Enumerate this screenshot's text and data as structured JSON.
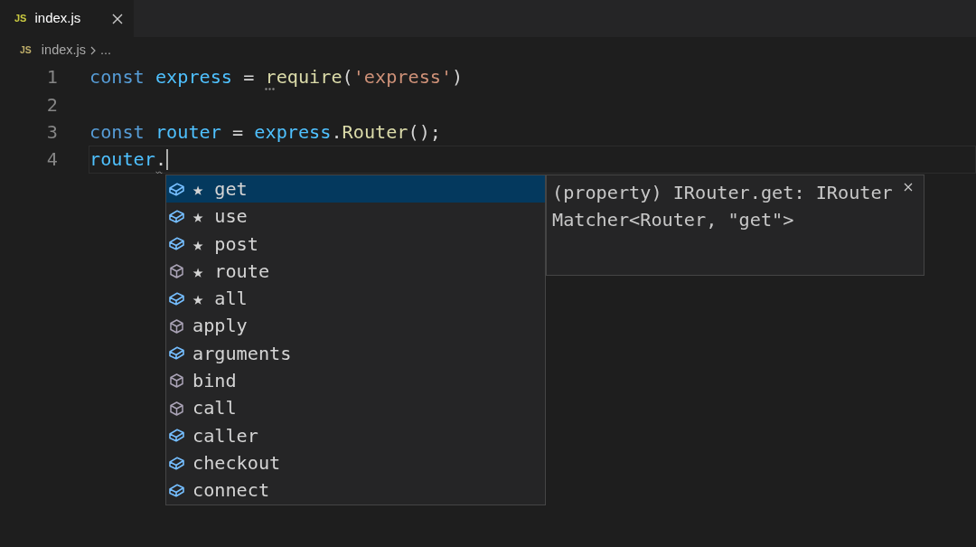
{
  "tab": {
    "file_badge": "JS",
    "title": "index.js",
    "active": true
  },
  "breadcrumb": {
    "file_badge": "JS",
    "items": [
      "index.js",
      "..."
    ]
  },
  "editor": {
    "lines": [
      {
        "number": "1",
        "active": false,
        "tokens": [
          {
            "kind": "keyword",
            "text": "const ",
            "dots": false,
            "squiggle": false
          },
          {
            "kind": "variable",
            "text": "express",
            "dots": false,
            "squiggle": false
          },
          {
            "kind": "plain",
            "text": " = ",
            "dots": false,
            "squiggle": false
          },
          {
            "kind": "function",
            "text": "require",
            "dots": true,
            "squiggle": false
          },
          {
            "kind": "plain",
            "text": "(",
            "dots": false,
            "squiggle": false
          },
          {
            "kind": "string",
            "text": "'express'",
            "dots": false,
            "squiggle": false
          },
          {
            "kind": "plain",
            "text": ")",
            "dots": false,
            "squiggle": false
          }
        ]
      },
      {
        "number": "2",
        "active": false
      },
      {
        "number": "3",
        "active": false,
        "tokens": [
          {
            "kind": "keyword",
            "text": "const ",
            "dots": false,
            "squiggle": false
          },
          {
            "kind": "variable",
            "text": "router",
            "dots": false,
            "squiggle": false
          },
          {
            "kind": "plain",
            "text": " = ",
            "dots": false,
            "squiggle": false
          },
          {
            "kind": "variable",
            "text": "express",
            "dots": false,
            "squiggle": false
          },
          {
            "kind": "plain",
            "text": ".",
            "dots": false,
            "squiggle": false
          },
          {
            "kind": "function",
            "text": "Router",
            "dots": false,
            "squiggle": false
          },
          {
            "kind": "plain",
            "text": "();",
            "dots": false,
            "squiggle": false
          }
        ]
      },
      {
        "number": "4",
        "active": true,
        "tokens": [
          {
            "kind": "variable",
            "text": "router",
            "dots": false,
            "squiggle": false
          },
          {
            "kind": "plain",
            "text": ".",
            "dots": false,
            "squiggle": true
          }
        ]
      }
    ]
  },
  "suggestions": {
    "items": [
      {
        "label": "★ get",
        "kind": "property",
        "selected": true
      },
      {
        "label": "★ use",
        "kind": "property",
        "selected": false
      },
      {
        "label": "★ post",
        "kind": "property",
        "selected": false
      },
      {
        "label": "★ route",
        "kind": "method",
        "selected": false
      },
      {
        "label": "★ all",
        "kind": "property",
        "selected": false
      },
      {
        "label": "apply",
        "kind": "method",
        "selected": false
      },
      {
        "label": "arguments",
        "kind": "property",
        "selected": false
      },
      {
        "label": "bind",
        "kind": "method",
        "selected": false
      },
      {
        "label": "call",
        "kind": "method",
        "selected": false
      },
      {
        "label": "caller",
        "kind": "property",
        "selected": false
      },
      {
        "label": "checkout",
        "kind": "property",
        "selected": false
      },
      {
        "label": "connect",
        "kind": "property",
        "selected": false
      }
    ]
  },
  "details": {
    "text": "(property) IRouter.get: IRouterMatcher<Router, \"get\">"
  }
}
